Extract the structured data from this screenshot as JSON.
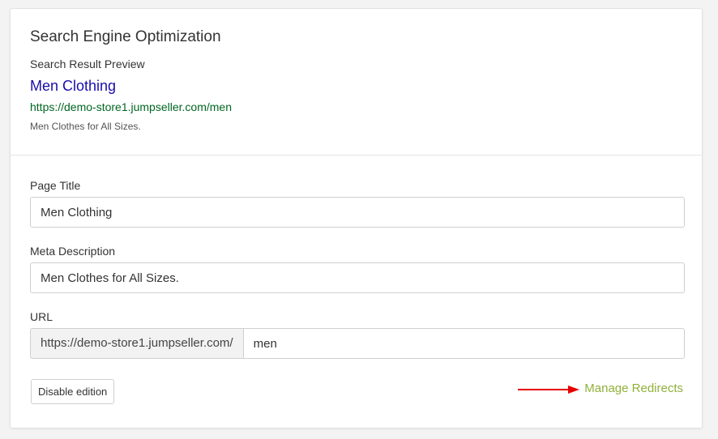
{
  "seo": {
    "title": "Search Engine Optimization",
    "preview_label": "Search Result Preview",
    "preview_title": "Men Clothing",
    "preview_url": "https://demo-store1.jumpseller.com/men",
    "preview_description": "Men Clothes for All Sizes."
  },
  "form": {
    "page_title_label": "Page Title",
    "page_title_value": "Men Clothing",
    "meta_description_label": "Meta Description",
    "meta_description_value": "Men Clothes for All Sizes.",
    "url_label": "URL",
    "url_prefix": "https://demo-store1.jumpseller.com/",
    "url_slug": "men"
  },
  "actions": {
    "disable_edition_label": "Disable edition",
    "manage_redirects_label": "Manage Redirects"
  },
  "colors": {
    "preview_title": "#1a0dab",
    "preview_url": "#006621",
    "manage_redirects": "#8fb13a",
    "annotation_arrow": "#e60000"
  },
  "icons": {
    "annotation": "red-arrow-icon"
  }
}
